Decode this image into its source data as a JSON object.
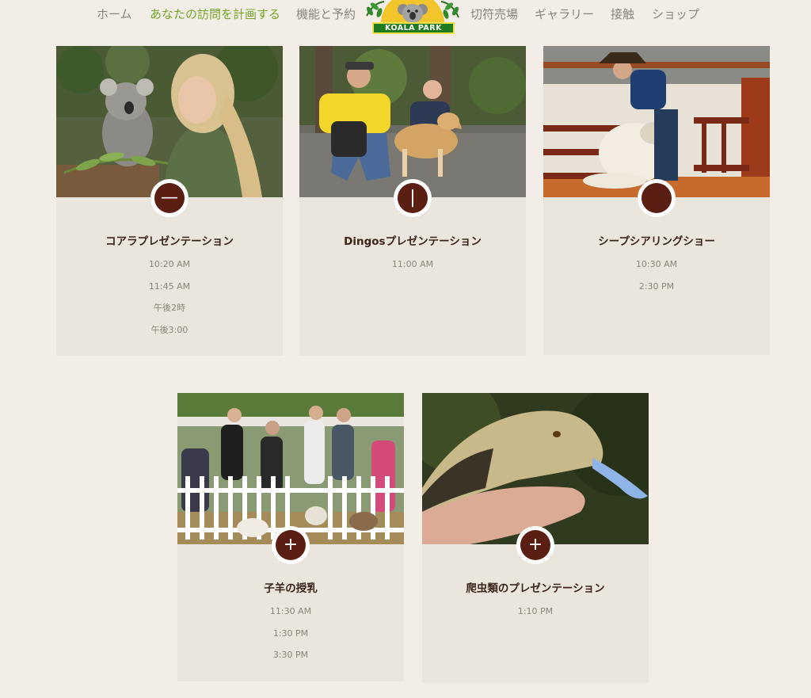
{
  "nav": {
    "items": [
      {
        "label": "ホーム",
        "active": false
      },
      {
        "label": "あなたの訪問を計画する",
        "active": true
      },
      {
        "label": "機能と予約",
        "active": false
      },
      {
        "label": "切符売場",
        "active": false
      },
      {
        "label": "ギャラリー",
        "active": false
      },
      {
        "label": "接触",
        "active": false
      },
      {
        "label": "ショップ",
        "active": false
      }
    ],
    "logo_text": "KOALA PARK"
  },
  "cards": [
    {
      "title": "コアラプレゼンテーション",
      "toggle": "—",
      "times": [
        "10:20 AM",
        "11:45 AM",
        "午後2時",
        "午後3:00"
      ],
      "photo": "koala-presentation-photo"
    },
    {
      "title": "Dingosプレゼンテーション",
      "toggle": "|",
      "times": [
        "11:00 AM"
      ],
      "photo": "dingo-presentation-photo"
    },
    {
      "title": "シープシアリングショー",
      "toggle": "",
      "times": [
        "10:30 AM",
        "2:30 PM"
      ],
      "photo": "sheep-shearing-photo"
    },
    {
      "title": "子羊の授乳",
      "toggle": "+",
      "times": [
        "11:30 AM",
        "1:30 PM",
        "3:30 PM"
      ],
      "photo": "lamb-feeding-photo"
    },
    {
      "title": "爬虫類のプレゼンテーション",
      "toggle": "+",
      "times": [
        "1:10 PM"
      ],
      "photo": "reptile-presentation-photo"
    }
  ],
  "colors": {
    "accent_nav": "#77a52a",
    "toggle_fill": "#5b1e12",
    "card_bg": "#eae6dd",
    "page_bg": "#f2eee7"
  }
}
